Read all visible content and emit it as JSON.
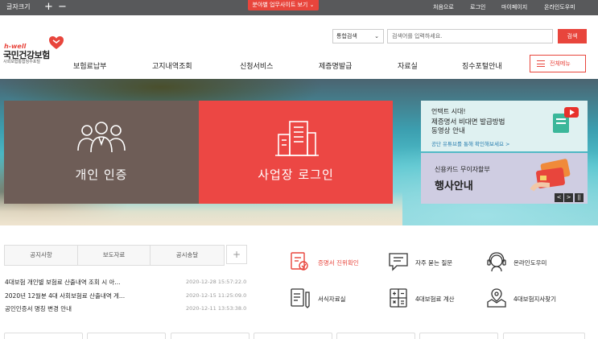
{
  "topbar": {
    "font_size_label": "글자크기",
    "plus": "+",
    "minus": "−",
    "site_button": "분야별 업무사이트 보기",
    "links": [
      "처음으로",
      "로그인",
      "마이페이지",
      "온라인도우미"
    ]
  },
  "logo": {
    "hwell": "h-well",
    "title": "국민건강보험",
    "subtitle": "사회보험통합징수포털"
  },
  "search": {
    "select_value": "통합검색",
    "placeholder": "검색어를 입력하세요.",
    "button": "검색"
  },
  "nav": {
    "items": [
      "보험료납부",
      "고지내역조회",
      "신청서비스",
      "제증명발급",
      "자료실",
      "징수포털안내"
    ],
    "menu_button": "전체메뉴"
  },
  "hero": {
    "personal": "개인 인증",
    "business": "사업장 로그인",
    "banner1": {
      "line1": "언택트 시대!",
      "line2": "제증명서 비대면 발급방법",
      "line3": "동영상 안내",
      "link": "공단 유튜브를 통해 확인해보세요 >"
    },
    "banner2": {
      "line1": "신용카드 무이자할부",
      "line2": "행사안내"
    },
    "controls": [
      "<",
      ">",
      "||"
    ]
  },
  "notices": {
    "tabs": [
      "공지사항",
      "보도자료",
      "공시송달"
    ],
    "plus": "+",
    "rows": [
      {
        "title": "4대보험 개인별 보험료 산출내역 조회 시 아...",
        "date": "2020-12-28 15:57:22.0"
      },
      {
        "title": "2020년 12월분 4대 사회보험료 산출내역 게...",
        "date": "2020-12-15 11:25:09.0"
      },
      {
        "title": "공인인증서 명칭 변경 안내",
        "date": "2020-12-11 13:53:38.0"
      }
    ]
  },
  "quick_links": [
    {
      "label": "증명서 진위확인",
      "icon": "certificate-check-icon",
      "highlight": true
    },
    {
      "label": "자주 묻는 질문",
      "icon": "faq-chat-icon",
      "highlight": false
    },
    {
      "label": "온라인도우미",
      "icon": "headset-helper-icon",
      "highlight": false
    },
    {
      "label": "서식자료실",
      "icon": "document-form-icon",
      "highlight": false
    },
    {
      "label": "4대보험료 계산",
      "icon": "calculator-icon",
      "highlight": false
    },
    {
      "label": "4대보험지사찾기",
      "icon": "map-location-icon",
      "highlight": false
    }
  ],
  "colors": {
    "accent": "#e8453c",
    "topbar": "#58595b",
    "personal_panel": "#6e5d57",
    "business_panel": "#ec4744"
  }
}
